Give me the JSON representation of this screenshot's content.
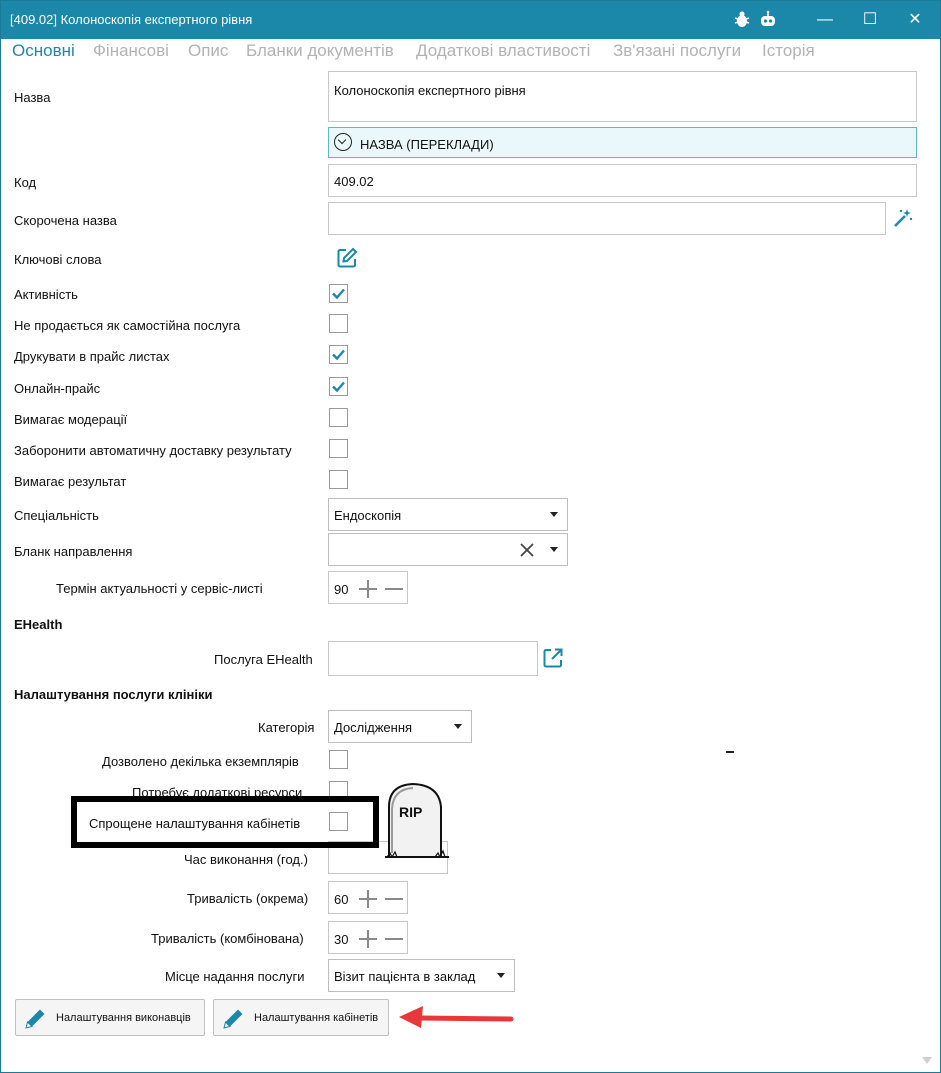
{
  "window": {
    "title": "[409.02] Колоноскопія експертного рівня",
    "bug_icon": "bug-icon",
    "robot_icon": "robot-icon",
    "minimize": "—",
    "maximize": "☐",
    "close": "✕"
  },
  "tabs": [
    "Основні",
    "Фінансові",
    "Опис",
    "Бланки документів",
    "Додаткові властивості",
    "Зв'язані послуги",
    "Історія"
  ],
  "form": {
    "name_label": "Назва",
    "name_value": "Колоноскопія експертного рівня",
    "translations_label": "НАЗВА (ПЕРЕКЛАДИ)",
    "code_label": "Код",
    "code_value": "409.02",
    "short_name_label": "Скорочена назва",
    "short_name_value": "",
    "keywords_label": "Ключові слова",
    "checkboxes": [
      {
        "label": "Активність",
        "checked": true
      },
      {
        "label": "Не продається як самостійна послуга",
        "checked": false
      },
      {
        "label": "Друкувати в прайс листах",
        "checked": true
      },
      {
        "label": "Онлайн-прайс",
        "checked": true
      },
      {
        "label": "Вимагає модерації",
        "checked": false
      },
      {
        "label": "Заборонити автоматичну доставку результату",
        "checked": false
      },
      {
        "label": "Вимагає результат",
        "checked": false
      }
    ],
    "specialty_label": "Спеціальність",
    "specialty_value": "Ендоскопія",
    "referral_label": "Бланк направлення",
    "referral_value": "",
    "relevance_label": "Термін актуальності у сервіс-листі",
    "relevance_value": "90"
  },
  "ehealth": {
    "header": "EHealth",
    "service_label": "Послуга EHealth",
    "service_value": ""
  },
  "clinic": {
    "header": "Налаштування послуги клініки",
    "category_label": "Категорія",
    "category_value": "Дослідження",
    "multi_copies_label": "Дозволено декілька екземплярів",
    "extra_resources_label": "Потребує додаткові ресурси",
    "simplified_rooms_label": "Спрощене налаштування кабінетів",
    "exec_time_label": "Час виконання (год.)",
    "exec_time_value": "",
    "duration_separate_label": "Тривалість (окрема)",
    "duration_separate_value": "60",
    "duration_combined_label": "Тривалість (комбінована)",
    "duration_combined_value": "30",
    "place_label": "Місце надання послуги",
    "place_value": "Візит пацієнта в заклад"
  },
  "buttons": {
    "performers": "Налаштування виконавців",
    "rooms": "Налаштування кабінетів"
  },
  "annotations": {
    "tombstone_text": "RIP",
    "arrow_color": "#e8383b"
  },
  "colors": {
    "accent": "#1b88aa",
    "check": "#1b88aa"
  }
}
